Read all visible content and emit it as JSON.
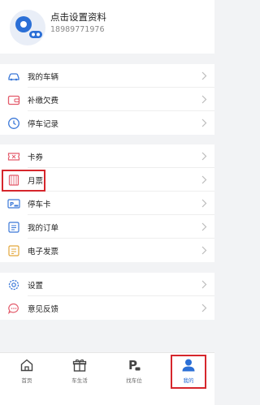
{
  "profile": {
    "name": "点击设置资料",
    "phone": "18989771976"
  },
  "groups": [
    {
      "items": [
        {
          "icon": "car-icon",
          "label": "我的车辆"
        },
        {
          "icon": "wallet-icon",
          "label": "补缴欠费"
        },
        {
          "icon": "clock-icon",
          "label": "停车记录"
        }
      ]
    },
    {
      "items": [
        {
          "icon": "coupon-icon",
          "label": "卡券"
        },
        {
          "icon": "calendar-icon",
          "label": "月票"
        },
        {
          "icon": "parking-card-icon",
          "label": "停车卡"
        },
        {
          "icon": "orders-icon",
          "label": "我的订单"
        },
        {
          "icon": "invoice-icon",
          "label": "电子发票"
        }
      ]
    },
    {
      "items": [
        {
          "icon": "gear-icon",
          "label": "设置"
        },
        {
          "icon": "chat-icon",
          "label": "意见反馈"
        }
      ]
    }
  ],
  "tabs": [
    {
      "icon": "home-icon",
      "label": "首页",
      "active": false
    },
    {
      "icon": "gift-icon",
      "label": "车生活",
      "active": false
    },
    {
      "icon": "parking-find-icon",
      "label": "找车位",
      "active": false
    },
    {
      "icon": "user-icon",
      "label": "我的",
      "active": true
    }
  ],
  "colors": {
    "accent": "#2b6fd6",
    "highlight": "#d6262c",
    "background": "#f2f3f5"
  }
}
